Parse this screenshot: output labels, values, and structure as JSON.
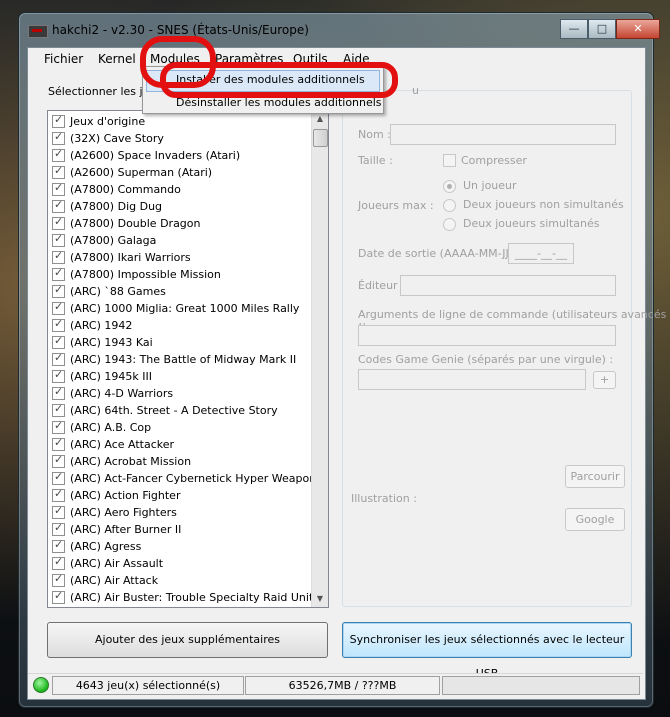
{
  "window": {
    "title": "hakchi2 - v2.30 - SNES (États-Unis/Europe)",
    "controls": {
      "minimize": "—",
      "maximize": "□",
      "close": "✕"
    }
  },
  "menu": [
    "Fichier",
    "Kernel",
    "Modules",
    "Paramètres",
    "Outils",
    "Aide"
  ],
  "modules_menu": {
    "items": [
      "Installer des modules additionnels",
      "Désinstaller les modules additionnels"
    ],
    "highlighted_index": 0
  },
  "games_list": {
    "label": "Sélectionner les jeu",
    "items": [
      "Jeux d'origine",
      "(32X) Cave Story",
      "(A2600) Space Invaders (Atari)",
      "(A2600) Superman (Atari)",
      "(A7800) Commando",
      "(A7800) Dig Dug",
      "(A7800) Double Dragon",
      "(A7800) Galaga",
      "(A7800) Ikari Warriors",
      "(A7800) Impossible Mission",
      "(ARC) `88 Games",
      "(ARC) 1000 Miglia: Great 1000 Miles Rally",
      "(ARC) 1942",
      "(ARC) 1943 Kai",
      "(ARC) 1943: The Battle of Midway Mark II",
      "(ARC) 1945k III",
      "(ARC) 4-D Warriors",
      "(ARC) 64th. Street - A Detective Story",
      "(ARC) A.B. Cop",
      "(ARC) Ace Attacker",
      "(ARC) Acrobat Mission",
      "(ARC) Act-Fancer Cybernetick Hyper Weapon",
      "(ARC) Action Fighter",
      "(ARC) Aero Fighters",
      "(ARC) After Burner II",
      "(ARC) Agress",
      "(ARC) Air Assault",
      "(ARC) Air Attack",
      "(ARC) Air Buster: Trouble Specialty Raid Unit"
    ]
  },
  "details": {
    "group_title": "u",
    "name_label": "Nom :",
    "size_label": "Taille :",
    "compress_label": "Compresser",
    "players_label": "Joueurs max :",
    "players_options": [
      "Un joueur",
      "Deux joueurs non simultanés",
      "Deux joueurs simultanés"
    ],
    "release_label": "Date de sortie (AAAA-MM-JJ) :",
    "release_value": "____-__-__",
    "publisher_label": "Éditeur :",
    "args_label": "Arguments de ligne de commande (utilisateurs avancés !)",
    "genie_label": "Codes Game Genie (séparés par une virgule) :",
    "genie_add": "+",
    "browse_button": "Parcourir",
    "illustration_label": "Illustration :",
    "google_button": "Google"
  },
  "buttons": {
    "add_games": "Ajouter des jeux supplémentaires",
    "sync": "Synchroniser les jeux sélectionnés avec le lecteur USB"
  },
  "status": {
    "selected": "4643 jeu(x) sélectionné(s)",
    "size": "63526,7MB / ???MB",
    "led_color": "#19b519"
  },
  "colors": {
    "annotation_red": "#e21010",
    "menu_highlight": "#dbe8f8"
  }
}
